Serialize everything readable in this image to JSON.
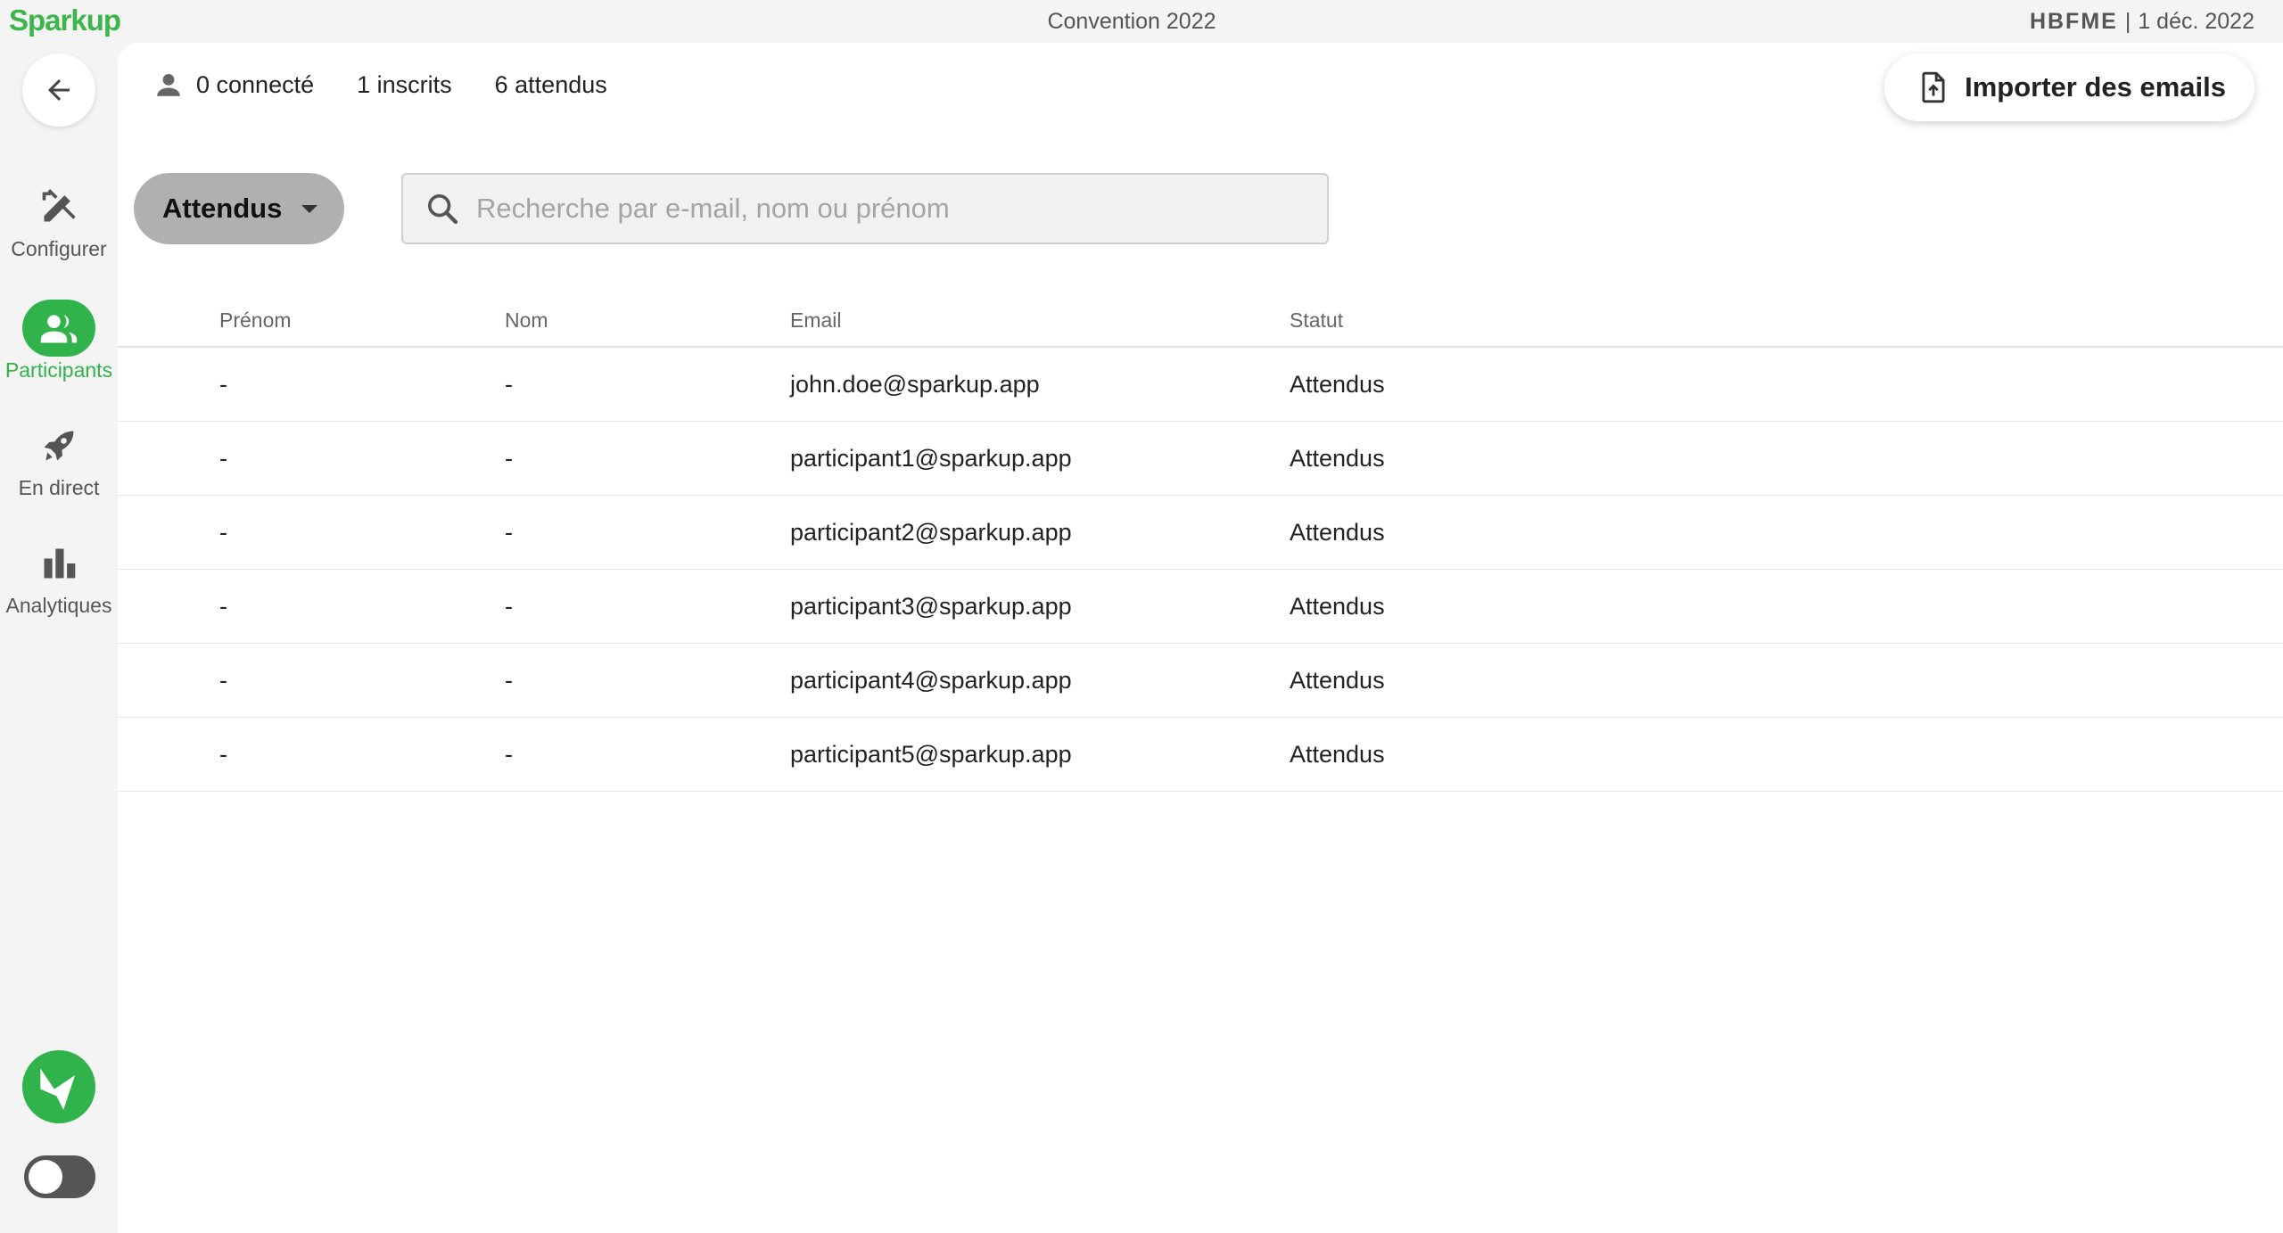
{
  "app": {
    "logo": "Sparkup"
  },
  "event": {
    "title": "Convention 2022",
    "org": "HBFME",
    "date": "1 déc. 2022"
  },
  "sidebar": {
    "items": [
      {
        "label": "Configurer",
        "icon": "tools-icon"
      },
      {
        "label": "Participants",
        "icon": "people-icon",
        "active": true
      },
      {
        "label": "En direct",
        "icon": "rocket-icon"
      },
      {
        "label": "Analytiques",
        "icon": "bar-chart-icon"
      }
    ]
  },
  "stats": {
    "connected": "0 connecté",
    "registered": "1 inscrits",
    "expected": "6 attendus"
  },
  "toolbar": {
    "import_label": "Importer des emails"
  },
  "filter": {
    "selected": "Attendus"
  },
  "search": {
    "placeholder": "Recherche par e-mail, nom ou prénom",
    "value": ""
  },
  "table": {
    "headers": {
      "firstname": "Prénom",
      "lastname": "Nom",
      "email": "Email",
      "status": "Statut"
    },
    "rows": [
      {
        "firstname": "-",
        "lastname": "-",
        "email": "john.doe@sparkup.app",
        "status": "Attendus"
      },
      {
        "firstname": "-",
        "lastname": "-",
        "email": "participant1@sparkup.app",
        "status": "Attendus"
      },
      {
        "firstname": "-",
        "lastname": "-",
        "email": "participant2@sparkup.app",
        "status": "Attendus"
      },
      {
        "firstname": "-",
        "lastname": "-",
        "email": "participant3@sparkup.app",
        "status": "Attendus"
      },
      {
        "firstname": "-",
        "lastname": "-",
        "email": "participant4@sparkup.app",
        "status": "Attendus"
      },
      {
        "firstname": "-",
        "lastname": "-",
        "email": "participant5@sparkup.app",
        "status": "Attendus"
      }
    ]
  },
  "colors": {
    "accent": "#2fb34a",
    "logo": "#3cb64a"
  }
}
